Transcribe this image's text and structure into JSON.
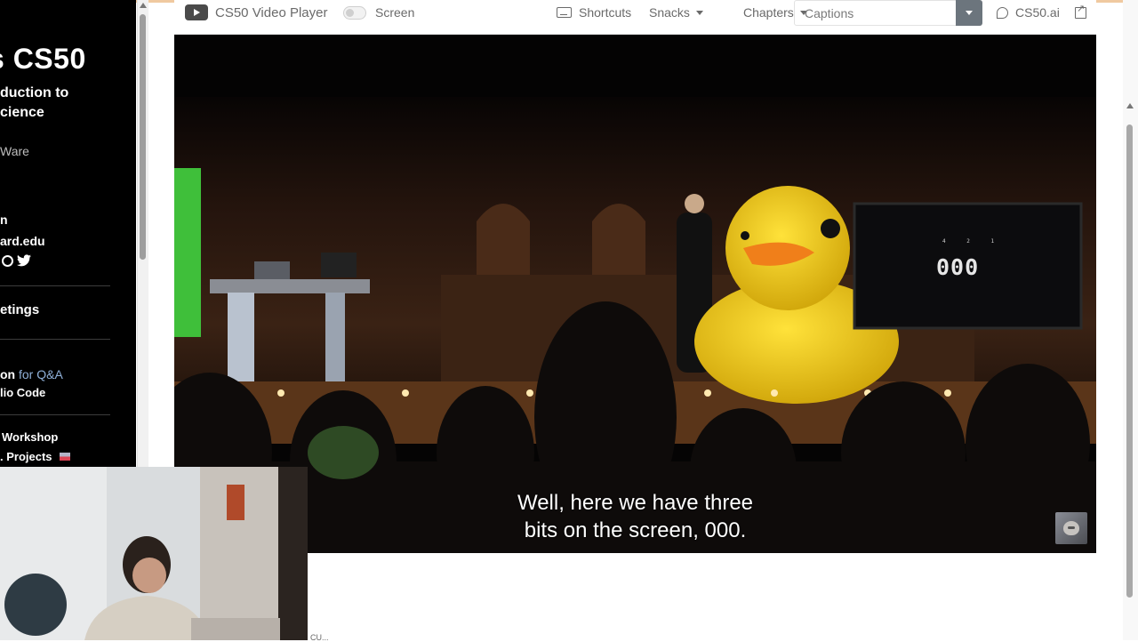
{
  "sidebar": {
    "title": "s CS50",
    "subtitle_line1": "duction to",
    "subtitle_line2": "cience",
    "instructor": "Ware",
    "line1": "n",
    "email": "ard.edu",
    "meetings": "etings",
    "qa_prefix": "on",
    "qa_suffix": " for Q&A",
    "vscode": "lio Code",
    "workshop": "Workshop",
    "projects": ". Projects"
  },
  "toolbar": {
    "title": "CS50 Video Player",
    "screen_label": "Screen",
    "shortcuts_label": "Shortcuts",
    "snacks_label": "Snacks",
    "chapters_label": "Chapters",
    "captions_value": "Captions",
    "cs50ai_label": "CS50.ai"
  },
  "video": {
    "subtitle_line1": "Well, here we have three",
    "subtitle_line2": "bits on the screen, 000.",
    "screen_digits": "000",
    "screen_place_labels": "4 2 1"
  },
  "bottom_stray_text": "CU...",
  "colors": {
    "sidebar_bg": "#000000",
    "duck_yellow": "#f4cd1d",
    "captions_button": "#6c757d"
  },
  "icons": [
    "youtube-icon",
    "keyboard-icon",
    "snacks-caret-icon",
    "chapters-caret-icon",
    "captions-dropdown-icon",
    "cs50ai-icon",
    "external-link-icon",
    "threads-icon",
    "twitter-icon",
    "flag-icon"
  ]
}
